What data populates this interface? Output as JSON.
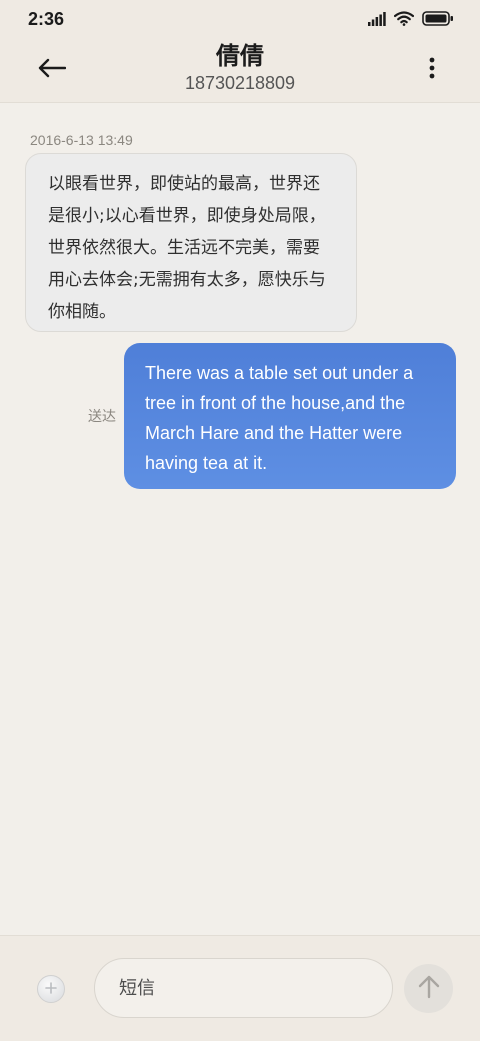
{
  "status_bar": {
    "time": "2:36"
  },
  "header": {
    "contact_name": "倩倩",
    "contact_number": "18730218809"
  },
  "conversation": {
    "timestamp": "2016-6-13 13:49",
    "incoming_message": "以眼看世界，即使站的最高，世界还是很小;以心看世界，即使身处局限，世界依然很大。生活远不完美，需要用心去体会;无需拥有太多，愿快乐与你相随。",
    "outgoing_message": "There was a table set out under a tree in front of the house,and the March Hare and the Hatter were having tea at it.",
    "outgoing_status": "送达"
  },
  "composer": {
    "placeholder": "短信"
  },
  "colors": {
    "background": "#f2efea",
    "outgoing_bubble": "#5585dc",
    "incoming_bubble": "#ececec"
  },
  "icons": [
    "signal-icon",
    "wifi-icon",
    "battery-icon",
    "back-arrow-icon",
    "more-vertical-icon",
    "add-icon",
    "send-arrow-icon"
  ]
}
